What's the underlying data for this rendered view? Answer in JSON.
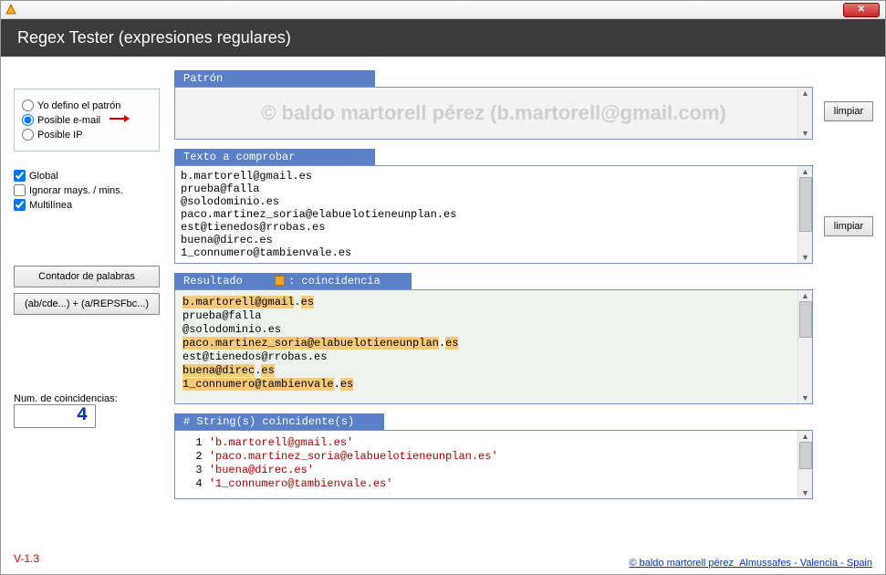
{
  "window": {
    "title_hidden": "",
    "close_glyph": "✕"
  },
  "header": {
    "title": "Regex Tester (expresiones regulares)"
  },
  "radios": {
    "opt1": "Yo defino el patrón",
    "opt2": "Posible e-mail",
    "opt3": "Posible IP",
    "selected": "opt2"
  },
  "checks": {
    "global": "Global",
    "ignore": "Ignorar mays. / mins.",
    "multi": "Multilínea",
    "global_checked": true,
    "ignore_checked": false,
    "multi_checked": true
  },
  "buttons": {
    "wordcount": "Contador de palabras",
    "capture": "(ab/cde...) + (a/REPSFbc...)",
    "clear": "limpiar"
  },
  "coincidences": {
    "label": "Num. de coincidencias:",
    "value": "4"
  },
  "version": "V-1.3",
  "credits": {
    "author": "© baldo martorell pérez",
    "location": "Almussafes - Valencia - Spain"
  },
  "sections": {
    "patron": {
      "header": "Patrón",
      "watermark": "© baldo martorell pérez (b.martorell@gmail.com)",
      "value": ""
    },
    "texto": {
      "header": "Texto a comprobar",
      "lines": [
        "b.martorell@gmail.es",
        "prueba@falla",
        "@solodominio.es",
        "paco.martinez_soria@elabuelotieneunplan.es",
        "est@tienedos@rrobas.es",
        "buena@direc.es",
        "1_connumero@tambienvale.es"
      ]
    },
    "resultado": {
      "header": "Resultado",
      "chip_label": ": coincidencia",
      "lines": [
        {
          "segments": [
            {
              "t": "b.martorell@gmail",
              "hl": true
            },
            {
              "t": ".",
              "hl": false
            },
            {
              "t": "es",
              "hl": true
            }
          ]
        },
        {
          "segments": [
            {
              "t": "prueba@falla",
              "hl": false
            }
          ]
        },
        {
          "segments": [
            {
              "t": "@solodominio.es",
              "hl": false
            }
          ]
        },
        {
          "segments": [
            {
              "t": "paco.martinez_soria@elabuelotieneunplan",
              "hl": true
            },
            {
              "t": ".",
              "hl": false
            },
            {
              "t": "es",
              "hl": true
            }
          ]
        },
        {
          "segments": [
            {
              "t": "est@tienedos@rrobas.es",
              "hl": false
            }
          ]
        },
        {
          "segments": [
            {
              "t": "buena@direc",
              "hl": true
            },
            {
              "t": ".",
              "hl": false
            },
            {
              "t": "es",
              "hl": true
            }
          ]
        },
        {
          "segments": [
            {
              "t": "1_connumero@tambienvale",
              "hl": true
            },
            {
              "t": ".",
              "hl": false
            },
            {
              "t": "es",
              "hl": true
            }
          ]
        }
      ]
    },
    "matches": {
      "header": " #  String(s) coincidente(s)",
      "rows": [
        {
          "n": "1",
          "s": "'b.martorell@gmail.es'"
        },
        {
          "n": "2",
          "s": "'paco.martinez_soria@elabuelotieneunplan.es'"
        },
        {
          "n": "3",
          "s": "'buena@direc.es'"
        },
        {
          "n": "4",
          "s": "'1_connumero@tambienvale.es'"
        }
      ]
    }
  }
}
